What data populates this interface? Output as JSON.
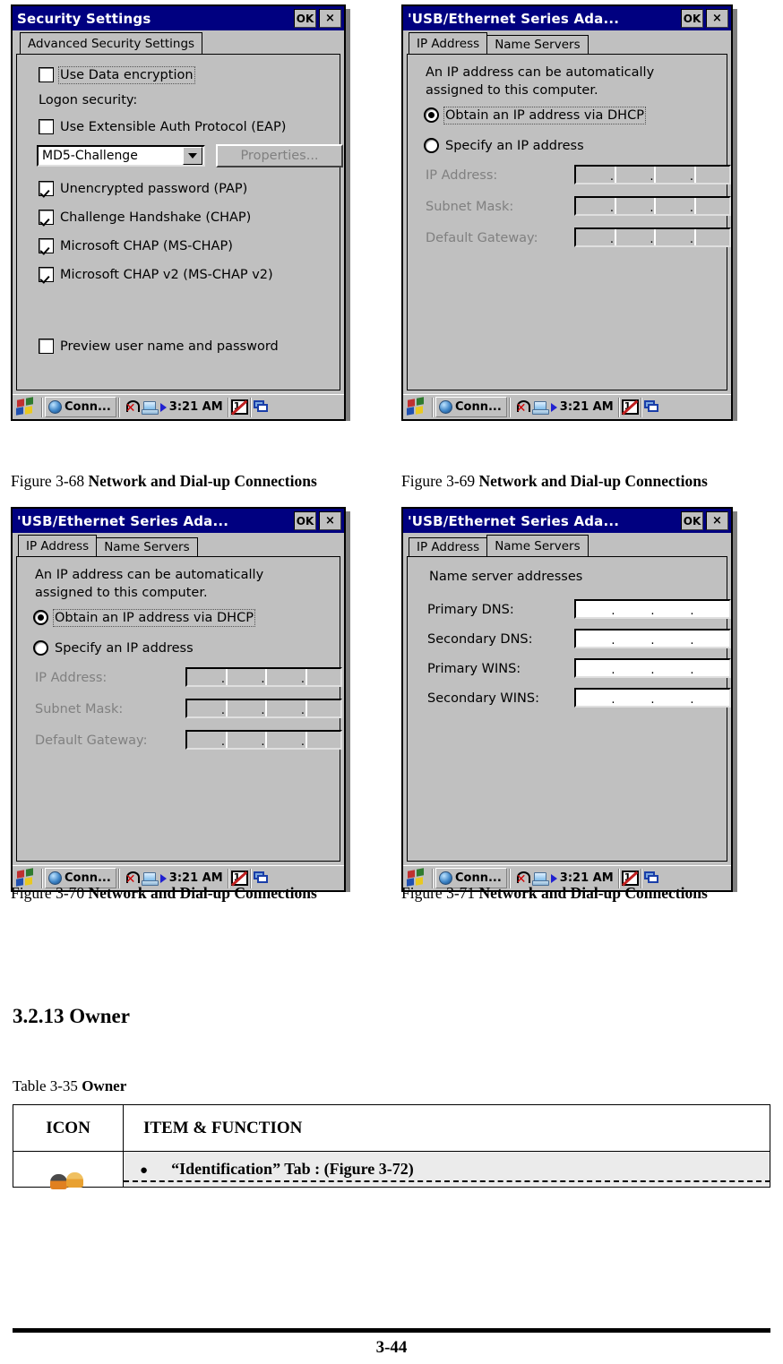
{
  "page": {
    "number": "3-44"
  },
  "dialogs": {
    "security_settings": {
      "title": "Security Settings",
      "ok_label": "OK",
      "close_label": "×",
      "tabs": [
        {
          "label": "Advanced Security Settings",
          "active": true
        }
      ],
      "use_data_encryption": {
        "label": "Use Data encryption",
        "checked": false
      },
      "logon_security_label": "Logon security:",
      "use_eap": {
        "label": "Use Extensible Auth Protocol (EAP)",
        "checked": false
      },
      "eap_method": {
        "value": "MD5-Challenge"
      },
      "properties_button": {
        "label": "Properties...",
        "disabled": true
      },
      "auth_options": [
        {
          "label": "Unencrypted password (PAP)",
          "checked": true
        },
        {
          "label": "Challenge Handshake  (CHAP)",
          "checked": true
        },
        {
          "label": "Microsoft CHAP (MS-CHAP)",
          "checked": true
        },
        {
          "label": "Microsoft CHAP v2 (MS-CHAP v2)",
          "checked": true
        }
      ],
      "preview_credentials": {
        "label": "Preview user name and password",
        "checked": false
      }
    },
    "usb_ethernet_ip": {
      "title": "'USB/Ethernet Series Ada...",
      "ok_label": "OK",
      "close_label": "×",
      "tabs": [
        {
          "label": "IP Address",
          "active": true
        },
        {
          "label": "Name Servers",
          "active": false
        }
      ],
      "description_line1": "An IP address can be automatically",
      "description_line2": "assigned to this computer.",
      "radio_dhcp": {
        "label": "Obtain an IP address via DHCP",
        "selected": true
      },
      "radio_specify": {
        "label": "Specify an IP address",
        "selected": false
      },
      "fields": [
        {
          "label": "IP Address:",
          "value": "",
          "disabled": true
        },
        {
          "label": "Subnet Mask:",
          "value": "",
          "disabled": true
        },
        {
          "label": "Default Gateway:",
          "value": "",
          "disabled": true
        }
      ]
    },
    "usb_ethernet_dns": {
      "title": "'USB/Ethernet Series Ada...",
      "ok_label": "OK",
      "close_label": "×",
      "tabs": [
        {
          "label": "IP Address",
          "active": false
        },
        {
          "label": "Name Servers",
          "active": true
        }
      ],
      "group_label": "Name server addresses",
      "fields": [
        {
          "label": "Primary DNS:",
          "value": ""
        },
        {
          "label": "Secondary DNS:",
          "value": ""
        },
        {
          "label": "Primary WINS:",
          "value": ""
        },
        {
          "label": "Secondary WINS:",
          "value": ""
        }
      ]
    }
  },
  "taskbar": {
    "start_icon": "windows-start-icon",
    "task_button_label": "Conn...",
    "task_button_icon": "globe-icon",
    "tray_network_icon": "network-disconnected-icon",
    "tray_pc_icon": "computer-icon",
    "tray_arrow_icon": "play-arrow-icon",
    "clock": "3:21 AM",
    "tray_input_icon": "input-panel-icon",
    "tray_cascade_icon": "cascade-windows-icon"
  },
  "captions": {
    "fig68": {
      "num": "Figure 3-68 ",
      "name": "Network and Dial-up Connections"
    },
    "fig69": {
      "num": "Figure 3-69 ",
      "name": "Network and Dial-up Connections"
    },
    "fig70": {
      "num": "Figure 3-70 ",
      "name": "Network and Dial-up Connections"
    },
    "fig71": {
      "num": "Figure 3-71 ",
      "name": "Network and Dial-up Connections"
    }
  },
  "section": {
    "heading": "3.2.13 Owner"
  },
  "table": {
    "caption_prefix": "Table 3-35 ",
    "caption_name": "Owner",
    "headers": {
      "icon": "ICON",
      "item": "ITEM & FUNCTION"
    },
    "rows": [
      {
        "icon_name": "owner-people-icon",
        "bullet": "●",
        "text": "“Identification” Tab : (Figure 3-72)"
      }
    ]
  }
}
